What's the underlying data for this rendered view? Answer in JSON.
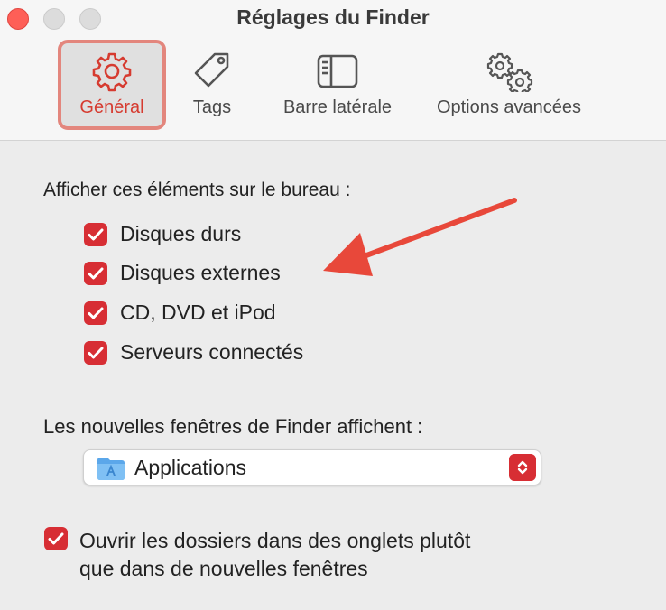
{
  "window": {
    "title": "Réglages du Finder"
  },
  "toolbar": {
    "tabs": [
      {
        "label": "Général",
        "icon": "gear-icon",
        "selected": true
      },
      {
        "label": "Tags",
        "icon": "tag-icon",
        "selected": false
      },
      {
        "label": "Barre latérale",
        "icon": "sidebar-icon",
        "selected": false
      },
      {
        "label": "Options avancées",
        "icon": "gears-icon",
        "selected": false
      }
    ]
  },
  "desktop_section": {
    "heading": "Afficher ces éléments sur le bureau :",
    "items": [
      {
        "label": "Disques durs",
        "checked": true
      },
      {
        "label": "Disques externes",
        "checked": true
      },
      {
        "label": "CD, DVD et iPod",
        "checked": true
      },
      {
        "label": "Serveurs connectés",
        "checked": true
      }
    ]
  },
  "new_window_section": {
    "heading": "Les nouvelles fenêtres de Finder affichent :",
    "selected_value": "Applications"
  },
  "tabs_option": {
    "line1": "Ouvrir les dossiers dans des onglets plutôt",
    "line2": "que dans de nouvelles fenêtres",
    "checked": true
  },
  "colors": {
    "accent": "#d72e34",
    "annotation_arrow": "#e8483a"
  }
}
